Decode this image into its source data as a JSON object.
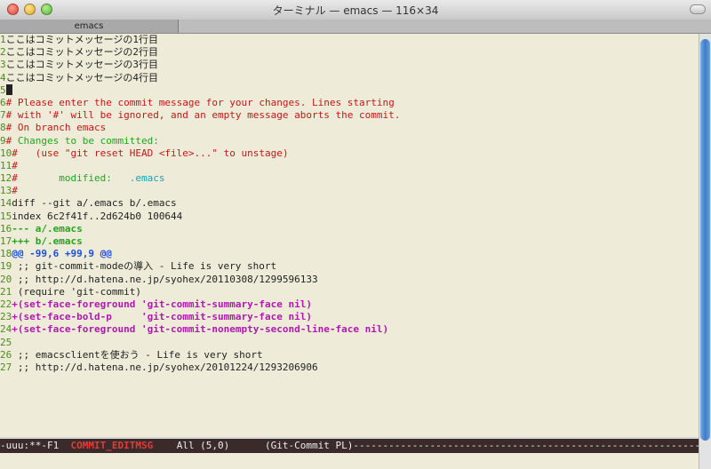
{
  "window": {
    "title": "ターミナル — emacs — 116×34",
    "tab_label": "emacs"
  },
  "colors": {
    "background": "#eeecd8",
    "comment_red": "#c01818",
    "green": "#22a51b",
    "cyan": "#1aa0b8",
    "magenta": "#b018b0",
    "blue": "#1c4fd8",
    "modeline_bg": "#3a2a2a",
    "scrollbar_thumb": "#3e7ccc"
  },
  "icons": {
    "close": "close-traffic-light-icon",
    "minimize": "minimize-traffic-light-icon",
    "maximize": "maximize-traffic-light-icon",
    "toolbar": "toolbar-toggle-icon"
  },
  "editor": {
    "lines": [
      {
        "num": "1",
        "segments": [
          {
            "t": "ここはコミットメッセージの1行目"
          }
        ]
      },
      {
        "num": "2",
        "segments": [
          {
            "t": "ここはコミットメッセージの2行目"
          }
        ]
      },
      {
        "num": "3",
        "segments": [
          {
            "t": "ここはコミットメッセージの3行目"
          }
        ]
      },
      {
        "num": "4",
        "segments": [
          {
            "t": "ここはコミットメッセージの4行目"
          }
        ]
      },
      {
        "num": "5",
        "cursor": true,
        "segments": []
      },
      {
        "num": "6",
        "segments": [
          {
            "t": "# Please enter the commit message for your changes. Lines starting",
            "c": "red"
          }
        ]
      },
      {
        "num": "7",
        "segments": [
          {
            "t": "# with '#' will be ignored, and an empty message aborts the commit.",
            "c": "red"
          }
        ]
      },
      {
        "num": "8",
        "segments": [
          {
            "t": "# On branch emacs",
            "c": "red"
          }
        ]
      },
      {
        "num": "9",
        "segments": [
          {
            "t": "# ",
            "c": "red"
          },
          {
            "t": "Changes to be committed:",
            "c": "green"
          }
        ]
      },
      {
        "num": "10",
        "segments": [
          {
            "t": "#   (use \"git reset HEAD <file>...\" to unstage)",
            "c": "red"
          }
        ]
      },
      {
        "num": "11",
        "segments": [
          {
            "t": "#",
            "c": "red"
          }
        ]
      },
      {
        "num": "12",
        "segments": [
          {
            "t": "#",
            "c": "red"
          },
          {
            "t": "       modified:   ",
            "c": "green"
          },
          {
            "t": ".emacs",
            "c": "cyan"
          }
        ]
      },
      {
        "num": "13",
        "segments": [
          {
            "t": "#",
            "c": "red"
          }
        ]
      },
      {
        "num": "14",
        "segments": [
          {
            "t": "diff --git a/.emacs b/.emacs"
          }
        ]
      },
      {
        "num": "15",
        "segments": [
          {
            "t": "index 6c2f41f..2d624b0 100644"
          }
        ]
      },
      {
        "num": "16",
        "segments": [
          {
            "t": "--- a/.emacs",
            "c": "green bold"
          }
        ]
      },
      {
        "num": "17",
        "segments": [
          {
            "t": "+++ b/.emacs",
            "c": "green bold"
          }
        ]
      },
      {
        "num": "18",
        "segments": [
          {
            "t": "@@ -99,6 +99,9 @@",
            "c": "blue"
          }
        ]
      },
      {
        "num": "19",
        "segments": [
          {
            "t": " ;; git-commit-modeの導入 - Life is very short"
          }
        ]
      },
      {
        "num": "20",
        "segments": [
          {
            "t": " ;; http://d.hatena.ne.jp/syohex/20110308/1299596133"
          }
        ]
      },
      {
        "num": "21",
        "segments": [
          {
            "t": " (require 'git-commit)"
          }
        ]
      },
      {
        "num": "22",
        "segments": [
          {
            "t": "+(set-face-foreground 'git-commit-summary-face nil)",
            "c": "magenta"
          }
        ]
      },
      {
        "num": "23",
        "segments": [
          {
            "t": "+(set-face-bold-p     'git-commit-summary-face nil)",
            "c": "magenta"
          }
        ]
      },
      {
        "num": "24",
        "segments": [
          {
            "t": "+(set-face-foreground 'git-commit-nonempty-second-line-face nil)",
            "c": "magenta"
          }
        ]
      },
      {
        "num": "25",
        "segments": []
      },
      {
        "num": "26",
        "segments": [
          {
            "t": " ;; emacsclientを使おう - Life is very short"
          }
        ]
      },
      {
        "num": "27",
        "segments": [
          {
            "t": " ;; http://d.hatena.ne.jp/syohex/20101224/1293206906"
          }
        ]
      }
    ]
  },
  "modeline": {
    "prefix": "-uuu:**-F1  ",
    "buffer": "COMMIT_EDITMSG",
    "position": "    All (5,0)      ",
    "mode": "(Git-Commit PL)",
    "fill": "------------------------------------------------------------------------------------------------"
  }
}
